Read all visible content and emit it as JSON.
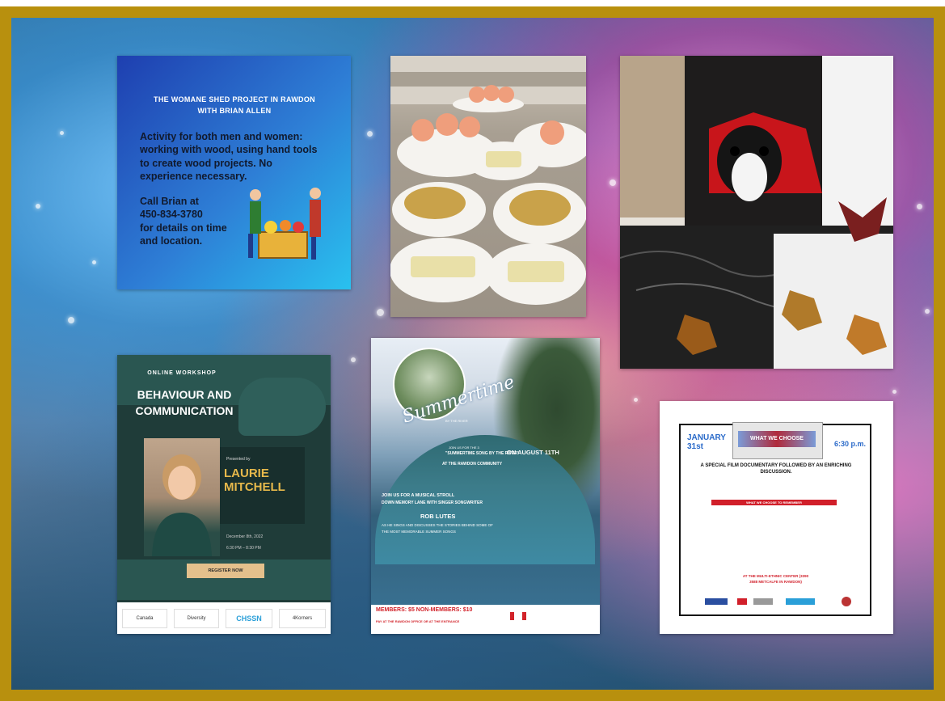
{
  "colors": {
    "frame_gold": "#b8900e",
    "poster_blue_start": "#1e3fb0",
    "poster_green": "#1f3c39",
    "red_accent": "#d11f2a"
  },
  "poster_woodshed": {
    "title_line1": "THE WOMANE SHED PROJECT IN RAWDON",
    "title_line2": "WITH BRIAN ALLEN",
    "body": "Activity for both men and women: working with wood, using hand tools to create wood projects. No experience necessary.",
    "call_line1": "Call Brian at",
    "call_line2": "450-834-3780",
    "call_line3": "for details on time and location."
  },
  "photo_tea": {
    "description_icon": "tea-tray-photo"
  },
  "photo_dog": {
    "description_icon": "dog-costume-photo"
  },
  "poster_workshop": {
    "eyebrow": "ONLINE WORKSHOP",
    "title_line1": "BEHAVIOUR AND",
    "title_line2": "COMMUNICATION",
    "presented_by": "Presented by",
    "name_line1": "LAURIE",
    "name_line2": "MITCHELL",
    "date": "December 8th, 2022",
    "time": "6:30 PM – 8:30 PM",
    "register": "REGISTER NOW",
    "logos": [
      "Canada",
      "Diversity",
      "CHSSN",
      "4Korners"
    ]
  },
  "poster_summertime": {
    "script_title": "Summertime",
    "by_the_river": "BY THE RIVER",
    "line_join": "JOIN US FOR THE 3",
    "line_title": "\"SUMMERTIME SONG BY THE RIVER\"",
    "line_on": "ON",
    "line_date": "AUGUST 11TH",
    "line_community": "AT THE RAWDON COMMUNITY",
    "line_a": "JOIN US FOR A MUSICAL STROLL",
    "line_b": "DOWN MEMORY LANE WITH SINGER SONGWRITER",
    "performer": "ROB LUTES",
    "line_c": "AS HE SINGS AND DISCUSSES THE STORIES BEHIND SOME OF",
    "line_d": "THE MOST MEMORABLE SUMMER SONGS",
    "members": "MEMBERS: $5  NON-MEMBERS: $10",
    "pay_at": "PAY AT THE RAWDON OFFICE OR AT THE ENTRANCE"
  },
  "poster_film": {
    "date_line1": "JANUARY",
    "date_line2": "31st",
    "time": "6:30 p.m.",
    "emblem_title": "WHAT WE CHOOSE",
    "heading": "A SPECIAL FILM DOCUMENTARY FOLLOWED BY AN ENRICHING DISCUSSION.",
    "red_banner": "WHAT WE CHOOSE TO REMEMBER",
    "venue_line1": "AT THE MULTI-ETHNIC CENTER (3390",
    "venue_line2": "3588 METCALFE IN RAWDON)"
  }
}
